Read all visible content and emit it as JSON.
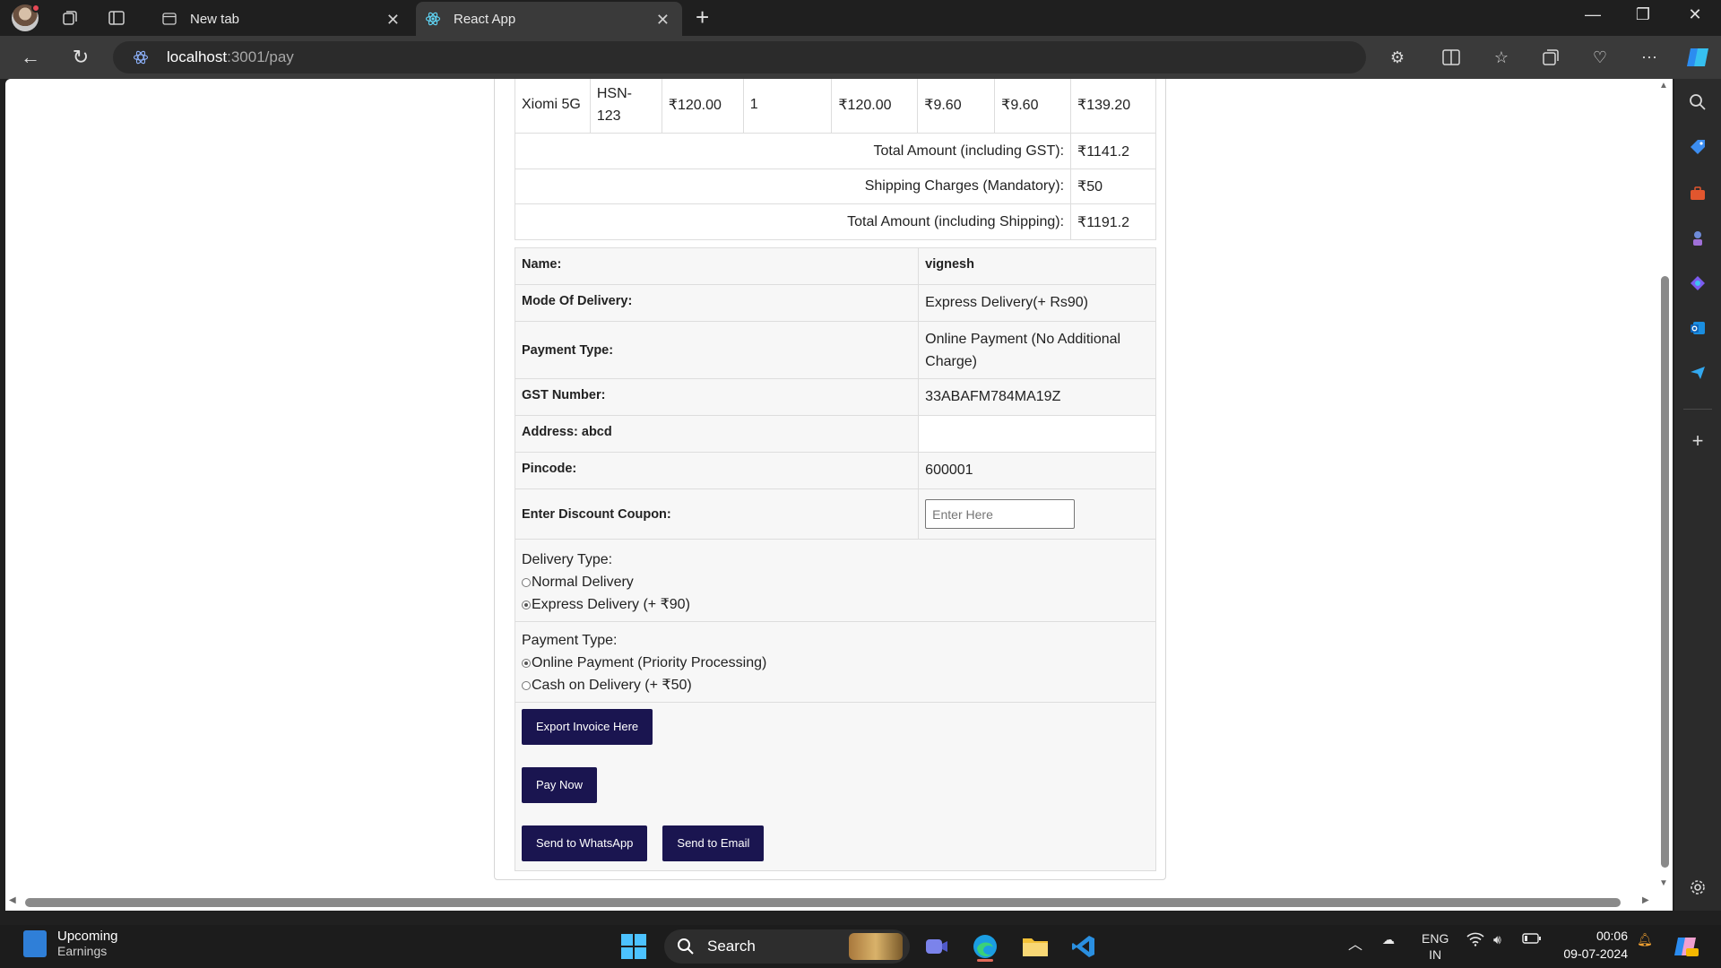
{
  "browser": {
    "tabs": [
      {
        "label": "New tab"
      },
      {
        "label": "React App"
      }
    ],
    "url_host": "localhost",
    "url_path": ":3001/pay"
  },
  "invoice": {
    "product_row": {
      "name": "Xiomi 5G",
      "hsn": "HSN-\n123",
      "price": "₹120.00",
      "qty": "1",
      "amount": "₹120.00",
      "cgst": "₹9.60",
      "sgst": "₹9.60",
      "total": "₹139.20"
    },
    "totals": [
      {
        "label": "Total Amount (including GST):",
        "value": "₹1141.2"
      },
      {
        "label": "Shipping Charges (Mandatory):",
        "value": "₹50"
      },
      {
        "label": "Total Amount (including Shipping):",
        "value": "₹1191.2"
      }
    ],
    "details": {
      "name_label": "Name:",
      "name_value": "vignesh",
      "delivery_label": "Mode Of Delivery:",
      "delivery_value": "Express Delivery(+ Rs90)",
      "payment_label": "Payment Type:",
      "payment_value": "Online Payment (No Additional Charge)",
      "gst_label": "GST Number:",
      "gst_value": "33ABAFM784MA19Z",
      "address_label": "Address: abcd",
      "pincode_label": "Pincode:",
      "pincode_value": "600001",
      "coupon_label": "Enter Discount Coupon:",
      "coupon_placeholder": "Enter Here"
    },
    "delivery_type": {
      "heading": "Delivery Type:",
      "options": [
        {
          "label": "Normal Delivery",
          "selected": false
        },
        {
          "label": "Express Delivery (+ ₹90)",
          "selected": true
        }
      ]
    },
    "payment_type": {
      "heading": "Payment Type:",
      "options": [
        {
          "label": "Online Payment (Priority Processing)",
          "selected": true
        },
        {
          "label": "Cash on Delivery (+ ₹50)",
          "selected": false
        }
      ]
    },
    "buttons": {
      "export": "Export Invoice Here",
      "pay": "Pay Now",
      "whatsapp": "Send to WhatsApp",
      "email": "Send to Email"
    }
  },
  "taskbar": {
    "weather_title": "Upcoming",
    "weather_sub": "Earnings",
    "search_label": "Search",
    "lang_top": "ENG",
    "lang_bottom": "IN",
    "time": "00:06",
    "date": "09-07-2024"
  },
  "colors": {
    "button_bg": "#1a1550",
    "accent": "#0078d4"
  }
}
